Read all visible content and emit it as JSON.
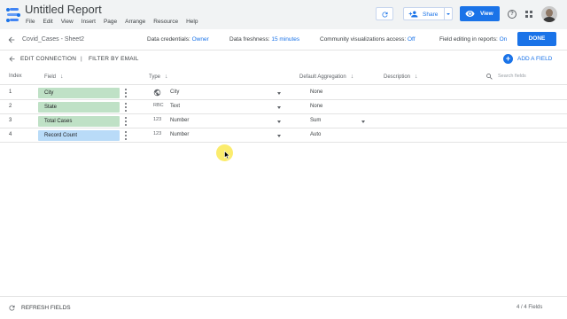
{
  "app": {
    "title": "Untitled Report",
    "menu": [
      "File",
      "Edit",
      "View",
      "Insert",
      "Page",
      "Arrange",
      "Resource",
      "Help"
    ],
    "share_label": "Share",
    "view_label": "View",
    "help_glyph": "?",
    "accent_color": "#1a73e8"
  },
  "datasource": {
    "name": "Covid_Cases - Sheet2",
    "credentials_label": "Data credentials:",
    "credentials_value": "Owner",
    "freshness_label": "Data freshness:",
    "freshness_value": "15 minutes",
    "community_label": "Community visualizations access:",
    "community_value": "Off",
    "field_editing_label": "Field editing in reports:",
    "field_editing_value": "On",
    "done_label": "DONE"
  },
  "toolbar": {
    "edit_connection": "EDIT CONNECTION",
    "separator": "|",
    "filter_by_email": "FILTER BY EMAIL",
    "add_field": "ADD A FIELD"
  },
  "table": {
    "headers": {
      "index": "Index",
      "field": "Field",
      "type": "Type",
      "aggregation": "Default Aggregation",
      "description": "Description"
    },
    "search_placeholder": "Search fields",
    "rows": [
      {
        "index": "1",
        "field": "City",
        "kind": "dimension",
        "type_icon": "globe-icon",
        "type": "City",
        "aggregation": "None"
      },
      {
        "index": "2",
        "field": "State",
        "kind": "dimension",
        "type_icon": "RBC",
        "type": "Text",
        "aggregation": "None"
      },
      {
        "index": "3",
        "field": "Total Cases",
        "kind": "dimension",
        "type_icon": "123",
        "type": "Number",
        "aggregation": "Sum"
      },
      {
        "index": "4",
        "field": "Record Count",
        "kind": "metric",
        "type_icon": "123",
        "type": "Number",
        "aggregation": "Auto"
      }
    ]
  },
  "footer": {
    "refresh_label": "REFRESH FIELDS",
    "count": "4 / 4 Fields"
  }
}
